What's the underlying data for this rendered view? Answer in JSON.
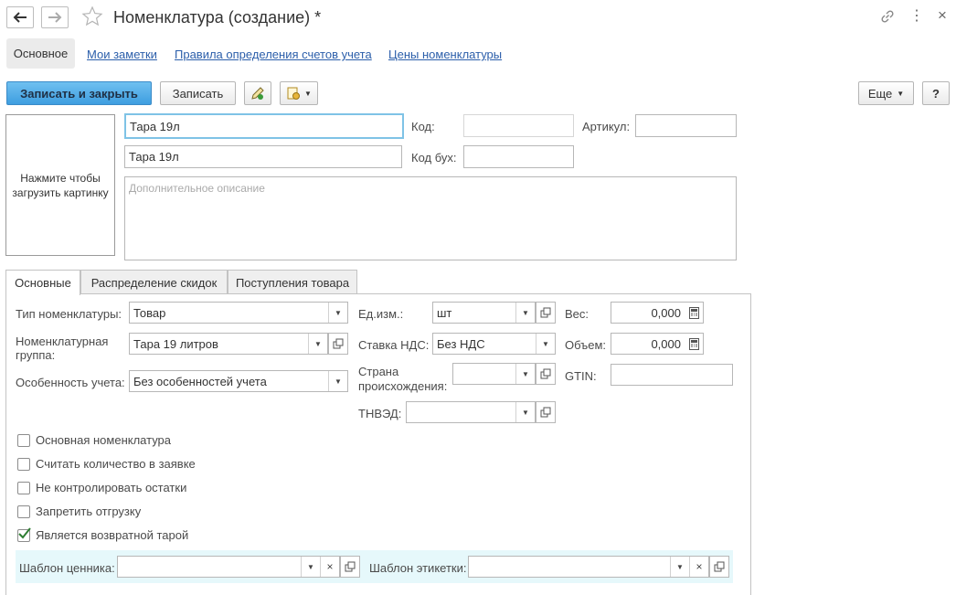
{
  "window": {
    "title": "Номенклатура (создание) *",
    "more_menu_icon": "⋮",
    "close_icon": "×"
  },
  "tabs_top": {
    "active": "Основное",
    "links": [
      "Мои заметки",
      "Правила определения счетов учета",
      "Цены номенклатуры"
    ]
  },
  "toolbar": {
    "save_close": "Записать и закрыть",
    "save": "Записать",
    "more": "Еще",
    "help": "?"
  },
  "image_placeholder": "Нажмите чтобы загрузить картинку",
  "header_fields": {
    "name_value": "Тара 19л",
    "full_name_value": "Тара 19л",
    "code_label": "Код:",
    "code_value": "",
    "article_label": "Артикул:",
    "article_value": "",
    "code_buh_label": "Код бух:",
    "code_buh_value": "",
    "description_placeholder": "Дополнительное описание"
  },
  "inner_tabs": [
    "Основные",
    "Распределение скидок",
    "Поступления товара"
  ],
  "fields": {
    "type_label": "Тип номенклатуры:",
    "type_value": "Товар",
    "group_label_line1": "Номенклатурная",
    "group_label_line2": "группа:",
    "group_value": "Тара 19 литров",
    "feature_label": "Особенность учета:",
    "feature_value": "Без особенностей учета",
    "unit_label": "Ед.изм.:",
    "unit_value": "шт",
    "vat_label": "Ставка НДС:",
    "vat_value": "Без НДС",
    "country_label_line1": "Страна",
    "country_label_line2": "происхождения:",
    "country_value": "",
    "tnved_label": "ТНВЭД:",
    "tnved_value": "",
    "weight_label": "Вес:",
    "weight_value": "0,000",
    "volume_label": "Объем:",
    "volume_value": "0,000",
    "gtin_label": "GTIN:",
    "gtin_value": ""
  },
  "checkboxes": [
    {
      "label": "Основная номенклатура",
      "checked": false
    },
    {
      "label": "Считать количество в заявке",
      "checked": false
    },
    {
      "label": "Не контролировать остатки",
      "checked": false
    },
    {
      "label": "Запретить отгрузку",
      "checked": false
    },
    {
      "label": "Является возвратной тарой",
      "checked": true
    }
  ],
  "templates": {
    "price_label": "Шаблон ценника:",
    "price_value": "",
    "label_label": "Шаблон этикетки:",
    "label_value": ""
  },
  "colors": {
    "primary_button": "#4aa8e8",
    "link": "#2b5eaa",
    "template_bar": "#e6f8fb",
    "active_input_border": "#7fc3e6",
    "checkmark": "#2e7d32"
  }
}
